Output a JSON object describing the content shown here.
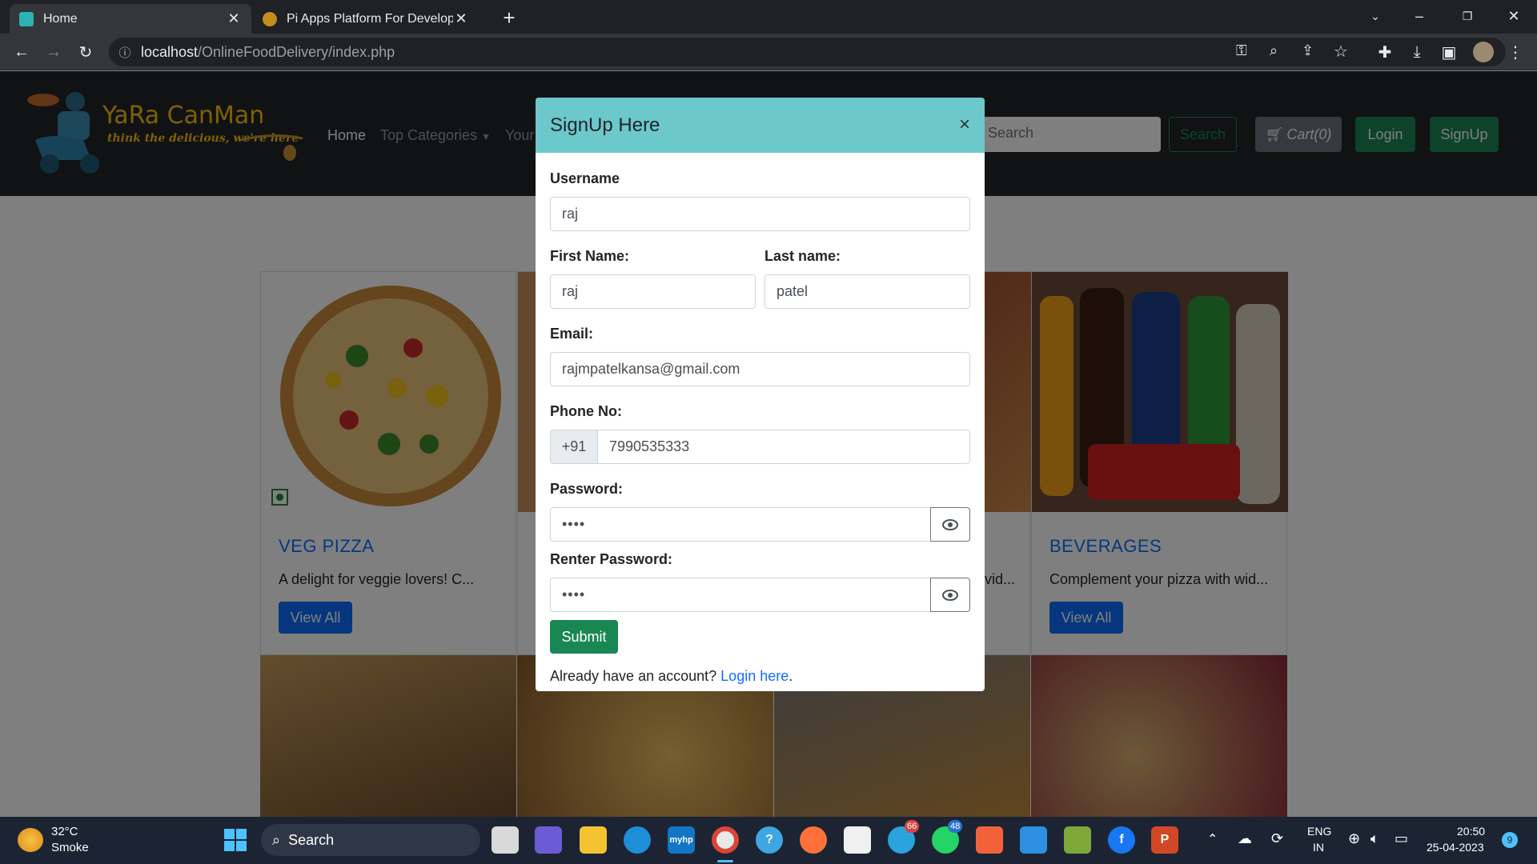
{
  "browser": {
    "tabs": [
      {
        "title": "Home",
        "active": true
      },
      {
        "title": "Pi Apps Platform For Developers",
        "active": false
      }
    ],
    "new_tab": "+",
    "url_host": "localhost",
    "url_path": "/OnlineFoodDelivery/index.php"
  },
  "site": {
    "logo_text": "YaRa CanMan",
    "logo_tagline": "think the delicious, we're here",
    "nav": {
      "home": "Home",
      "top_categories": "Top Categories",
      "your": "Your"
    },
    "search_placeholder": "Search",
    "search_button": "Search",
    "cart_button": "Cart(0)",
    "login_button": "Login",
    "signup_button": "SignUp"
  },
  "cards": [
    {
      "title": "VEG PIZZA",
      "text": "A delight for veggie lovers! C...",
      "button": "View All"
    },
    {
      "title": "",
      "text": "",
      "button": ""
    },
    {
      "title": "",
      "text": "vid...",
      "button": ""
    },
    {
      "title": "BEVERAGES",
      "text": "Complement your pizza with wid...",
      "button": "View All"
    }
  ],
  "modal": {
    "title": "SignUp Here",
    "close": "×",
    "username_label": "Username",
    "username_value": "raj",
    "firstname_label": "First Name:",
    "firstname_value": "raj",
    "lastname_label": "Last name:",
    "lastname_value": "patel",
    "email_label": "Email:",
    "email_value": "rajmpatelkansa@gmail.com",
    "phone_label": "Phone No:",
    "phone_prefix": "+91",
    "phone_value": "7990535333",
    "password_label": "Password:",
    "password_value": "••••",
    "repassword_label": "Renter Password:",
    "repassword_value": "••••",
    "submit": "Submit",
    "footer_text": "Already have an account?",
    "footer_link": "Login here",
    "footer_end": "."
  },
  "taskbar": {
    "weather_temp": "32°C",
    "weather_desc": "Smoke",
    "search": "Search",
    "telegram_badge": "66",
    "whatsapp_badge": "48",
    "lang_top": "ENG",
    "lang_bottom": "IN",
    "time": "20:50",
    "date": "25-04-2023",
    "notifications": "9"
  },
  "colors": {
    "modal_header": "#6cc8cb",
    "primary": "#0d6efd",
    "success": "#198754",
    "navbar": "#212529"
  }
}
